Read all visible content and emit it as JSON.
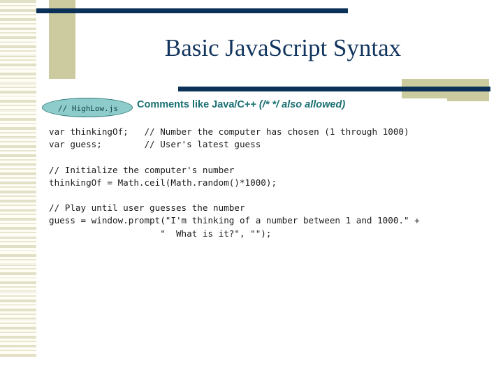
{
  "slide": {
    "title": "Basic Java.Script Syntax",
    "title_text": "Basic JavaScript Syntax",
    "callout": {
      "label": "// HighLow.js"
    },
    "note": {
      "main": "Comments like Java/C++ ",
      "emphasis": "(/* */ also allowed)"
    },
    "code": {
      "lines": [
        "var thinkingOf;   // Number the computer has chosen (1 through 1000)",
        "var guess;        // User's latest guess",
        "",
        "// Initialize the computer's number",
        "thinkingOf = Math.ceil(Math.random()*1000);",
        "",
        "// Play until user guesses the number",
        "guess = window.prompt(\"I'm thinking of a number between 1 and 1000.\" +",
        "                     \"  What is it?\", \"\");"
      ]
    }
  },
  "colors": {
    "navy": "#0b3158",
    "title_navy": "#12355e",
    "khaki": "#cccb9f",
    "stripe_light": "#fffdf4",
    "stripe_dark": "#e2e0c6",
    "teal_text": "#1a6f72",
    "callout_fill": "#8ecccb",
    "callout_border": "#2e7a7a",
    "code_text": "#1b1b1b",
    "background": "#ffffff"
  }
}
